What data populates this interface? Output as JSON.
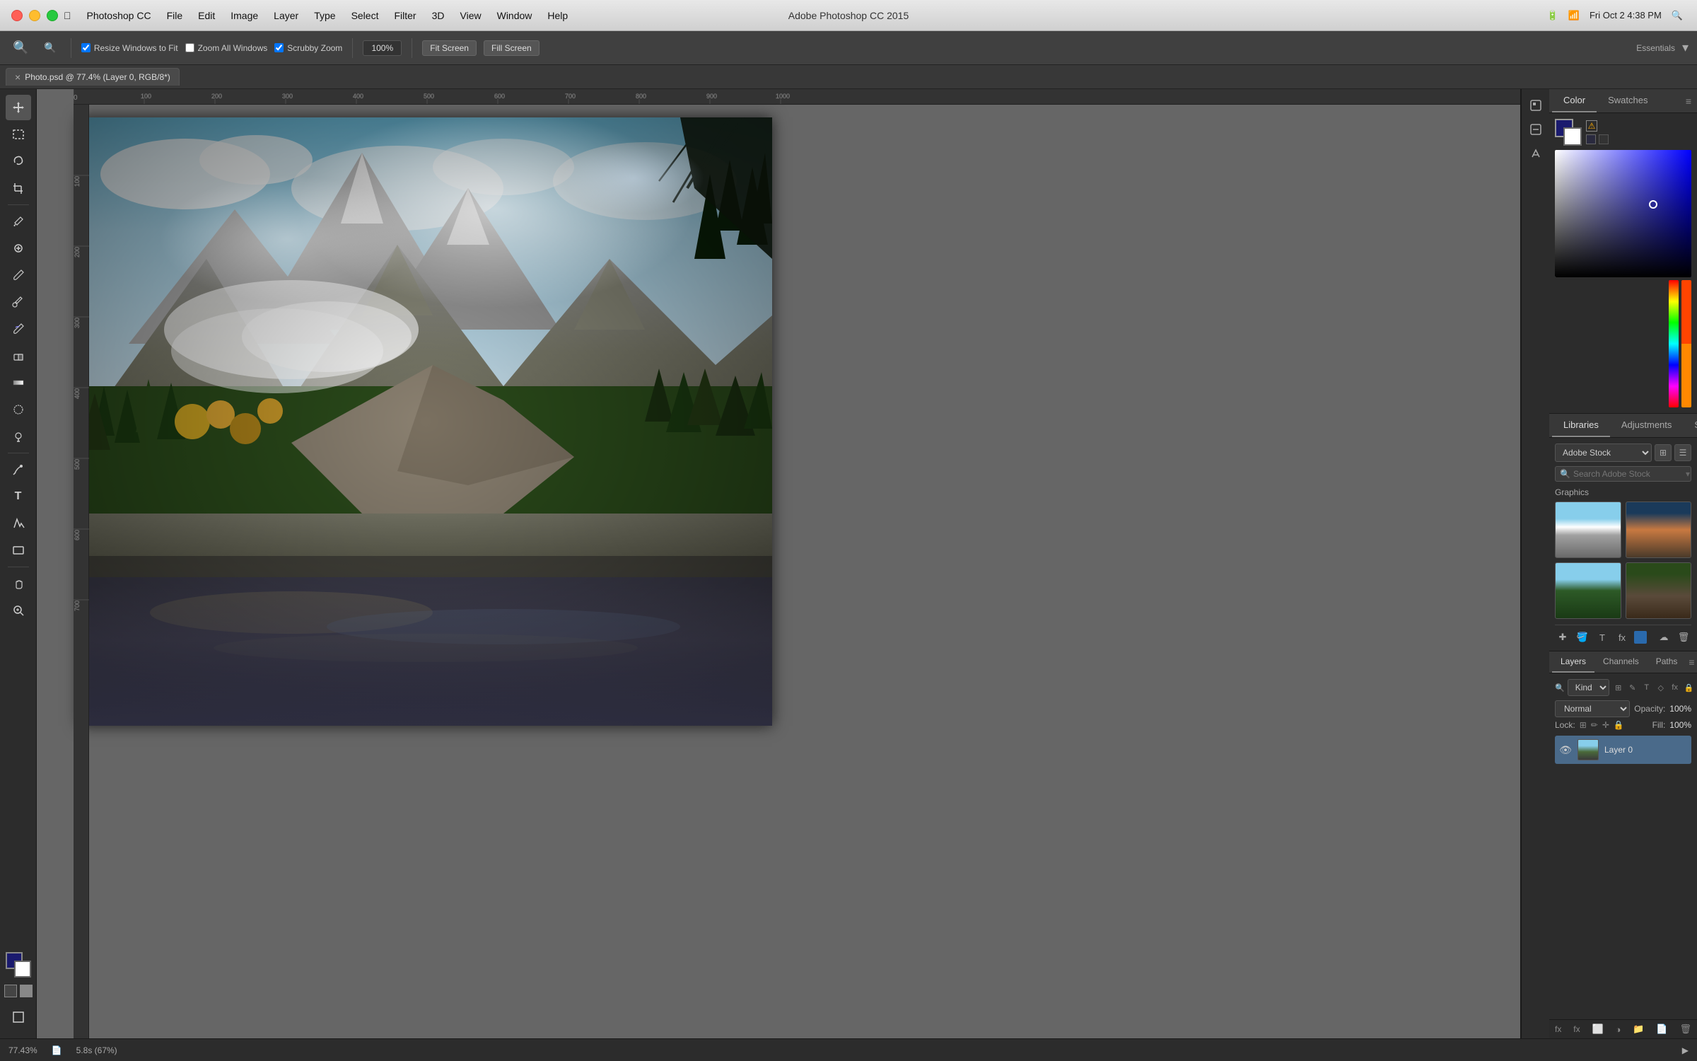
{
  "titlebar": {
    "app_name": "Photoshop CC",
    "title": "Adobe Photoshop CC 2015",
    "menu": [
      "",
      "Photoshop CC",
      "File",
      "Edit",
      "Image",
      "Layer",
      "Type",
      "Select",
      "Filter",
      "3D",
      "View",
      "Window",
      "Help"
    ],
    "zoom": "100%",
    "time": "Fri Oct 2  4:38 PM",
    "workspace": "Essentials"
  },
  "toolbar": {
    "resize_windows": "Resize Windows to Fit",
    "zoom_all": "Zoom All Windows",
    "scrubby": "Scrubby Zoom",
    "zoom_value": "100%",
    "fit_screen": "Fit Screen",
    "fill_screen": "Fill Screen"
  },
  "tab": {
    "name": "Photo.psd @ 77.4% (Layer 0, RGB/8*)",
    "close": "×"
  },
  "color_panel": {
    "tab_color": "Color",
    "tab_swatches": "Swatches"
  },
  "libraries": {
    "tab_libraries": "Libraries",
    "tab_adjustments": "Adjustments",
    "tab_styles": "Styles",
    "dropdown": "Adobe Stock",
    "search_placeholder": "Search Adobe Stock",
    "graphics_label": "Graphics"
  },
  "layers": {
    "tab_layers": "Layers",
    "tab_channels": "Channels",
    "tab_paths": "Paths",
    "filter_label": "Kind",
    "blend_mode": "Normal",
    "opacity_label": "Opacity:",
    "opacity_val": "100%",
    "lock_label": "Lock:",
    "fill_label": "Fill:",
    "fill_val": "100%",
    "layer0_name": "Layer 0"
  },
  "status": {
    "zoom": "77.43%",
    "time": "5.8s (67%)"
  },
  "icons": {
    "zoom_in": "🔍",
    "zoom_out": "🔎",
    "move": "✥",
    "select_rect": "▭",
    "lasso": "⌒",
    "crop": "⊡",
    "eyedropper": "✒",
    "healing": "⊕",
    "brush": "✏",
    "clone": "✐",
    "eraser": "◻",
    "gradient": "▦",
    "blur": "◉",
    "dodge": "◑",
    "pen": "✒",
    "type": "T",
    "shape": "▱",
    "hand": "✋",
    "zoom": "⊕",
    "eye": "👁",
    "search": "🔍",
    "grid": "⊞",
    "list": "☰",
    "add": "✚",
    "trash": "🗑",
    "fx": "fx",
    "adjust": "⊙",
    "mask": "⬜",
    "new_layer": "📄",
    "link": "🔗",
    "lock": "🔒",
    "filter_pixel": "⊞",
    "filter_adj": "✎",
    "filter_move": "✛",
    "filter_path": "◇",
    "filter_lock": "🔒"
  }
}
